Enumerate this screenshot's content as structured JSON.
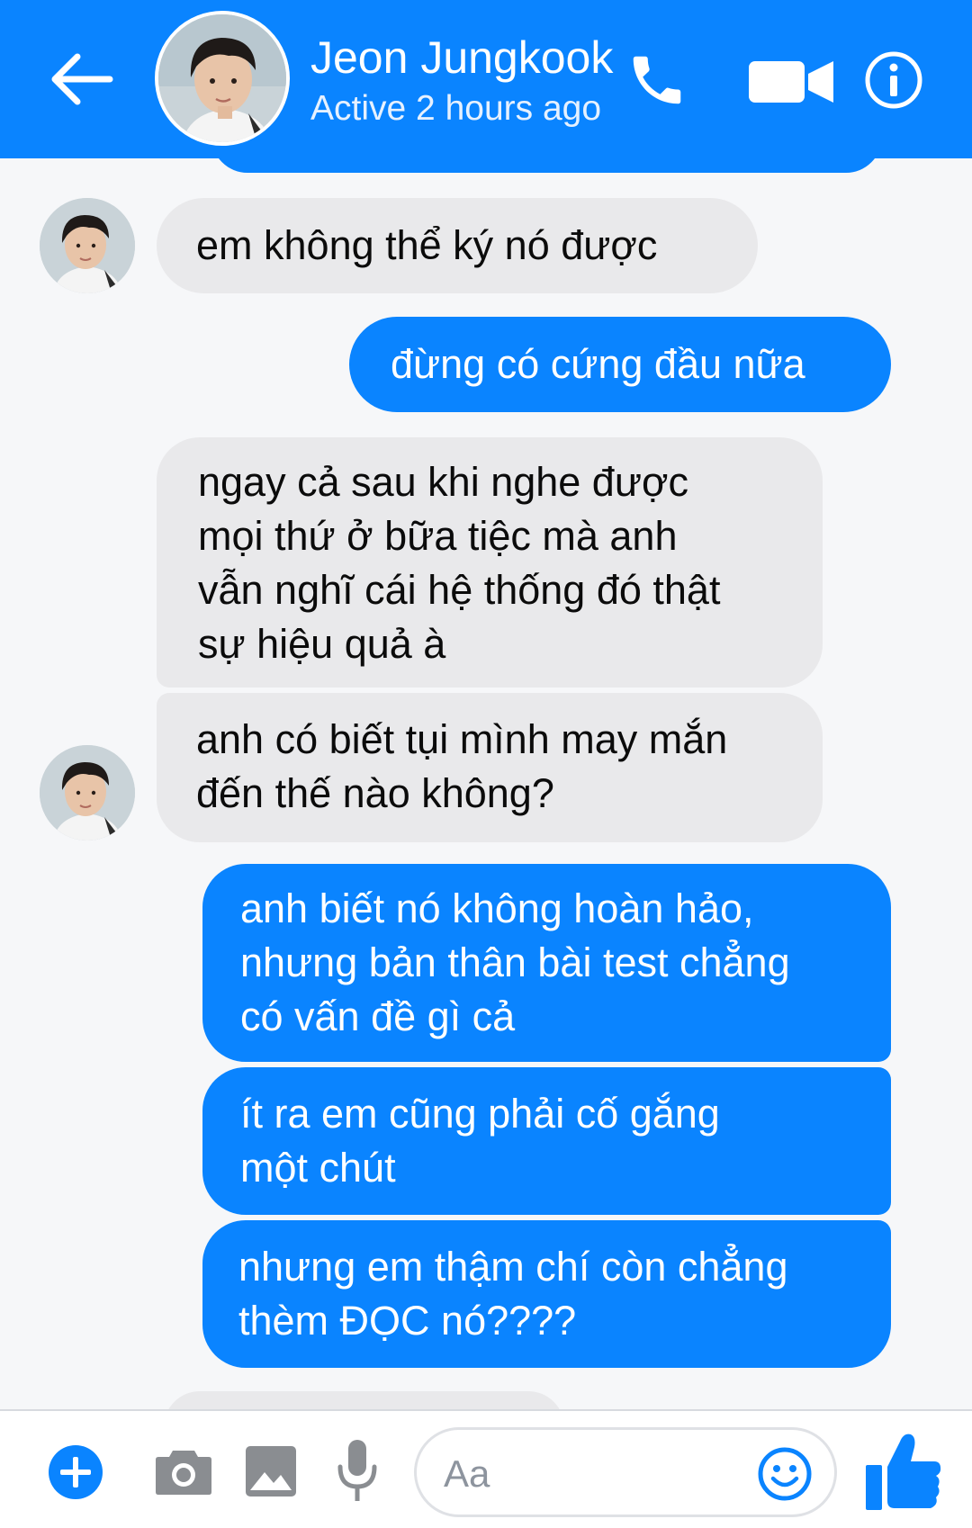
{
  "colors": {
    "accent": "#0a84ff",
    "incoming_bubble": "#e9e9eb",
    "background": "#f6f7f9"
  },
  "header": {
    "back_icon": "back-arrow-icon",
    "contact_name": "Jeon Jungkook",
    "status": "Active 2 hours ago",
    "actions": [
      "phone-icon",
      "video-camera-icon",
      "info-icon"
    ]
  },
  "messages": [
    {
      "direction": "incoming",
      "lines": [
        "em không thể ký nó được"
      ]
    },
    {
      "direction": "outgoing",
      "lines": [
        "đừng có cứng đầu nữa"
      ]
    },
    {
      "direction": "incoming",
      "lines": [
        "ngay cả sau khi nghe được",
        "mọi thứ ở bữa tiệc mà anh",
        "vẫn nghĩ cái hệ thống đó thật",
        "sự hiệu quả à"
      ]
    },
    {
      "direction": "incoming",
      "lines": [
        "anh có biết tụi mình may mắn",
        "đến thế nào không?"
      ]
    },
    {
      "direction": "outgoing",
      "lines": [
        "anh biết nó không hoàn hảo,",
        "nhưng bản thân bài test chẳng",
        "có vấn đề gì cả"
      ]
    },
    {
      "direction": "outgoing",
      "lines": [
        "ít ra em cũng phải cố gắng",
        "một chút"
      ]
    },
    {
      "direction": "outgoing",
      "lines": [
        "nhưng em thậm chí còn chẳng",
        "thèm ĐỌC nó????"
      ]
    }
  ],
  "composer": {
    "placeholder": "Aa",
    "icons": [
      "plus-icon",
      "camera-icon",
      "image-icon",
      "microphone-icon",
      "emoji-icon",
      "thumbs-up-icon"
    ]
  }
}
